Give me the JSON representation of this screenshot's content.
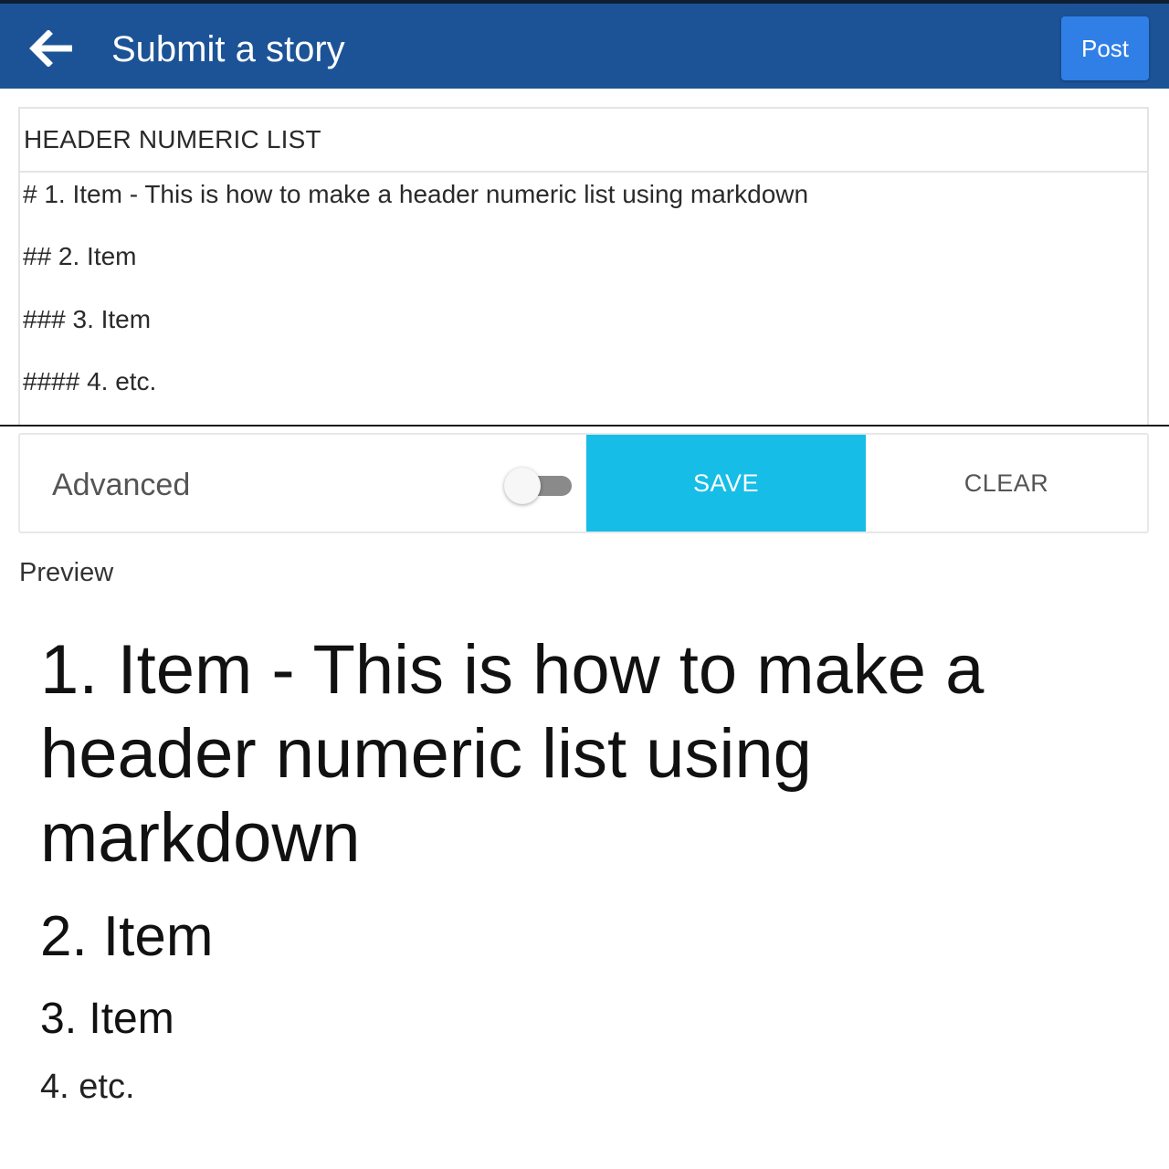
{
  "appbar": {
    "title": "Submit a story",
    "back_icon": "arrow-left-icon",
    "post_label": "Post",
    "color": "#1c5397",
    "post_color": "#2f7fe6"
  },
  "editor": {
    "title_value": "HEADER NUMERIC LIST",
    "body_lines": [
      "# 1. Item - This is how to make a header numeric list using markdown",
      "## 2. Item",
      "### 3. Item",
      "#### 4. etc."
    ]
  },
  "controls": {
    "advanced_label": "Advanced",
    "advanced_enabled": false,
    "save_label": "SAVE",
    "clear_label": "CLEAR",
    "save_color": "#16bde6"
  },
  "preview": {
    "label": "Preview",
    "h1": "1. Item - This is how to make a header numeric list using markdown",
    "h2": "2. Item",
    "h3": "3. Item",
    "h4": "4. etc."
  }
}
